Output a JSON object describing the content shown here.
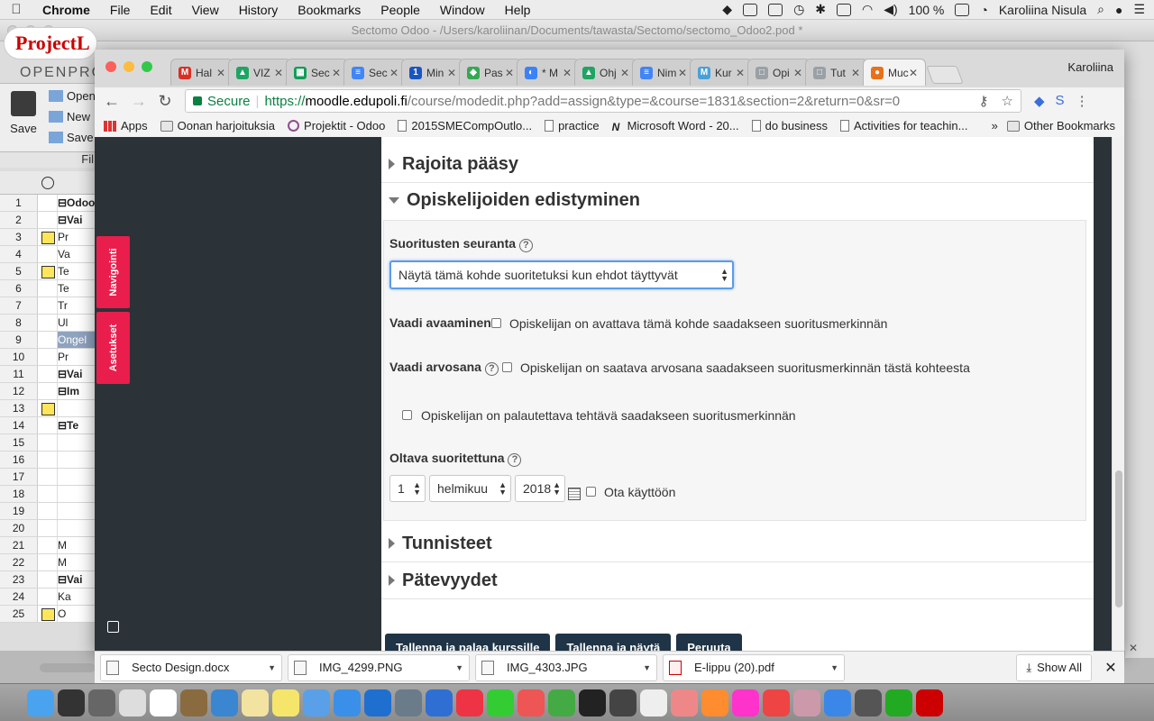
{
  "menubar": {
    "app": "Chrome",
    "items": [
      "File",
      "Edit",
      "View",
      "History",
      "Bookmarks",
      "People",
      "Window",
      "Help"
    ],
    "battery": "100 %",
    "user": "Karoliina Nisula"
  },
  "background_window": {
    "title": "Sectomo Odoo - /Users/karoliinan/Documents/tawasta/Sectomo/sectomo_Odoo2.pod *",
    "logo": "ProjectL",
    "brand": "OPENPRO",
    "ribbon": {
      "save": "Save",
      "commands": [
        "Open",
        "New",
        "Save"
      ],
      "group": "Fil"
    },
    "rows": [
      {
        "n": "1",
        "cal": false,
        "name": "⊟Odoo",
        "bold": true,
        "sel": false
      },
      {
        "n": "2",
        "cal": false,
        "name": " ⊟Vai",
        "bold": true,
        "sel": false
      },
      {
        "n": "3",
        "cal": true,
        "name": "      Pr",
        "bold": false,
        "sel": false
      },
      {
        "n": "4",
        "cal": false,
        "name": "      Va",
        "bold": false,
        "sel": false
      },
      {
        "n": "5",
        "cal": true,
        "name": "      Te",
        "bold": false,
        "sel": false
      },
      {
        "n": "6",
        "cal": false,
        "name": "      Te",
        "bold": false,
        "sel": false
      },
      {
        "n": "7",
        "cal": false,
        "name": "      Tr",
        "bold": false,
        "sel": false
      },
      {
        "n": "8",
        "cal": false,
        "name": "      Ul",
        "bold": false,
        "sel": false
      },
      {
        "n": "9",
        "cal": false,
        "name": "Ongel",
        "bold": false,
        "sel": true
      },
      {
        "n": "10",
        "cal": false,
        "name": "      Pr",
        "bold": false,
        "sel": false
      },
      {
        "n": "11",
        "cal": false,
        "name": " ⊟Vai",
        "bold": true,
        "sel": false
      },
      {
        "n": "12",
        "cal": false,
        "name": "   ⊟Im",
        "bold": true,
        "sel": false
      },
      {
        "n": "13",
        "cal": true,
        "name": "",
        "bold": false,
        "sel": false
      },
      {
        "n": "14",
        "cal": false,
        "name": "   ⊟Te",
        "bold": true,
        "sel": false
      },
      {
        "n": "15",
        "cal": false,
        "name": "",
        "bold": false,
        "sel": false
      },
      {
        "n": "16",
        "cal": false,
        "name": "",
        "bold": false,
        "sel": false
      },
      {
        "n": "17",
        "cal": false,
        "name": "",
        "bold": false,
        "sel": false
      },
      {
        "n": "18",
        "cal": false,
        "name": "",
        "bold": false,
        "sel": false
      },
      {
        "n": "19",
        "cal": false,
        "name": "",
        "bold": false,
        "sel": false
      },
      {
        "n": "20",
        "cal": false,
        "name": "",
        "bold": false,
        "sel": false
      },
      {
        "n": "21",
        "cal": false,
        "name": "      M",
        "bold": false,
        "sel": false
      },
      {
        "n": "22",
        "cal": false,
        "name": "      M",
        "bold": false,
        "sel": false
      },
      {
        "n": "23",
        "cal": false,
        "name": " ⊟Vai",
        "bold": true,
        "sel": false
      },
      {
        "n": "24",
        "cal": false,
        "name": "      Ka",
        "bold": false,
        "sel": false
      },
      {
        "n": "25",
        "cal": true,
        "name": "      O",
        "bold": false,
        "sel": false
      }
    ]
  },
  "browser": {
    "profile": "Karoliina",
    "tabs": [
      {
        "label": "Hal",
        "fav": "M",
        "color": "#d93025"
      },
      {
        "label": "VIZ",
        "fav": "▲",
        "color": "#1fa463"
      },
      {
        "label": "Sec",
        "fav": "▦",
        "color": "#0f9d58"
      },
      {
        "label": "Sec",
        "fav": "≡",
        "color": "#4285f4"
      },
      {
        "label": "Min",
        "fav": "1",
        "color": "#1a56c2"
      },
      {
        "label": "Pas",
        "fav": "◆",
        "color": "#34a853"
      },
      {
        "label": "* M",
        "fav": "◐",
        "color": "#3b82f6"
      },
      {
        "label": "Ohj",
        "fav": "▲",
        "color": "#1fa463"
      },
      {
        "label": "Nim",
        "fav": "≡",
        "color": "#4285f4"
      },
      {
        "label": "Kur",
        "fav": "M",
        "color": "#48a0d8"
      },
      {
        "label": "Opi",
        "fav": "□",
        "color": "#9aa0a6"
      },
      {
        "label": "Tut",
        "fav": "□",
        "color": "#9aa0a6"
      },
      {
        "label": "Muc",
        "fav": "●",
        "color": "#e8711a"
      }
    ],
    "secure": "Secure",
    "url_scheme": "https://",
    "url_host": "moodle.edupoli.fi",
    "url_path": "/course/modedit.php?add=assign&type=&course=1831&section=2&return=0&sr=0",
    "bookmarks": [
      {
        "label": "Apps",
        "icon": "apps"
      },
      {
        "label": "Oonan harjoituksia",
        "icon": "folder"
      },
      {
        "label": "Projektit - Odoo",
        "icon": "odoo"
      },
      {
        "label": "2015SMECompOutlo...",
        "icon": "page"
      },
      {
        "label": "practice",
        "icon": "page"
      },
      {
        "label": "Microsoft Word - 20...",
        "icon": "n"
      },
      {
        "label": "do business",
        "icon": "page"
      },
      {
        "label": "Activities for teachin...",
        "icon": "page"
      }
    ],
    "more": "»",
    "other_bookmarks": "Other Bookmarks"
  },
  "moodle": {
    "side_tabs": [
      "Navigointi",
      "Asetukset"
    ],
    "sections": {
      "restrict": "Rajoita pääsy",
      "completion": "Opiskelijoiden edistyminen",
      "tags": "Tunnisteet",
      "competencies": "Pätevyydet"
    },
    "tracking_label": "Suoritusten seuranta",
    "tracking_value": "Näytä tämä kohde suoritetuksi kun ehdot täyttyvät",
    "require_view_label": "Vaadi avaaminen",
    "require_view_text": "Opiskelijan on avattava tämä kohde saadakseen suoritusmerkinnän",
    "require_grade_label": "Vaadi arvosana",
    "require_grade_text": "Opiskelijan on saatava arvosana saadakseen suoritusmerkinnän tästä kohteesta",
    "require_submit_text": "Opiskelijan on palautettava tehtävä saadakseen suoritusmerkinnän",
    "expected_label": "Oltava suoritettuna",
    "date": {
      "day": "1",
      "month": "helmikuu",
      "year": "2018"
    },
    "enable_text": "Ota käyttöön",
    "buttons": [
      "Tallenna ja palaa kurssille",
      "Tallenna ja näytä",
      "Peruuta"
    ]
  },
  "downloads": {
    "items": [
      "Secto Design.docx",
      "IMG_4299.PNG",
      "IMG_4303.JPG",
      "E-lippu (20).pdf"
    ],
    "show_all": "Show All"
  },
  "dock_colors": [
    "#4aa3ef",
    "#333",
    "#666",
    "#ddd",
    "#fff",
    "#8a6b40",
    "#3b86d1",
    "#f3e3a0",
    "#f5e66b",
    "#5aa0e8",
    "#3a8fe8",
    "#1f6fd1",
    "#6a7b8a",
    "#2f6fd3",
    "#e34",
    "#3c3",
    "#e55",
    "#4a4",
    "#222",
    "#444",
    "#eee",
    "#e88",
    "#ff8c2f",
    "#f3c",
    "#e44",
    "#c9a",
    "#3a87e8",
    "#555",
    "#2a2",
    "#c00"
  ]
}
